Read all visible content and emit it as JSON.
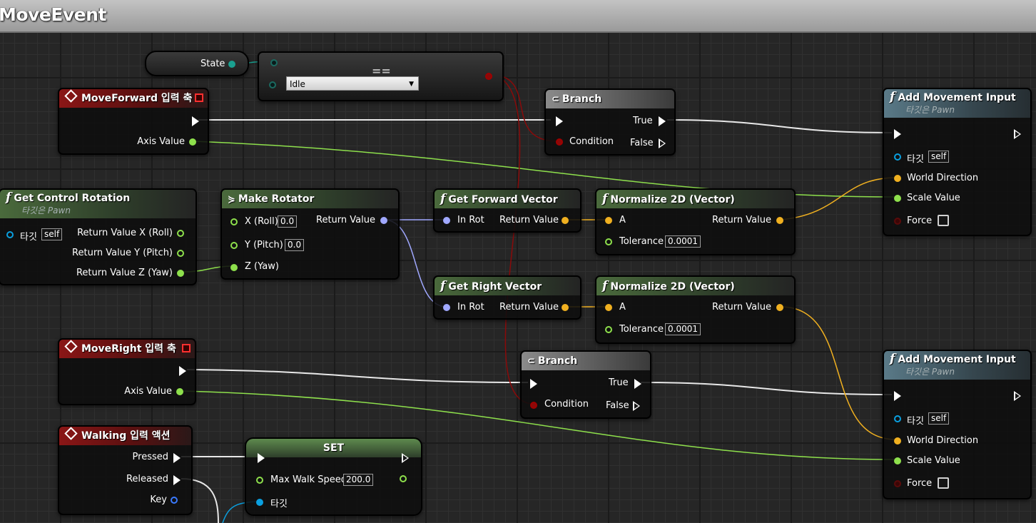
{
  "window": {
    "title": "MoveEvent"
  },
  "nodes": {
    "state": {
      "label": "State"
    },
    "equal": {
      "op": "==",
      "enum_value": "Idle"
    },
    "moveforward": {
      "title": "MoveForward 입력 축",
      "axis_value": "Axis Value"
    },
    "branch1": {
      "title": "Branch",
      "condition": "Condition",
      "true_label": "True",
      "false_label": "False"
    },
    "add1": {
      "title": "Add Movement Input",
      "subtitle": "타깃은 Pawn",
      "target": "타깃",
      "self": "self",
      "world_direction": "World Direction",
      "scale_value": "Scale Value",
      "force": "Force"
    },
    "getcontrol": {
      "title": "Get Control Rotation",
      "subtitle": "타깃은 Pawn",
      "target": "타깃",
      "self": "self",
      "rx": "Return Value X (Roll)",
      "ry": "Return Value Y (Pitch)",
      "rz": "Return Value Z (Yaw)"
    },
    "makerot": {
      "title": "Make Rotator",
      "x": "X (Roll)",
      "x_val": "0.0",
      "y": "Y (Pitch)",
      "y_val": "0.0",
      "z": "Z (Yaw)",
      "ret": "Return Value"
    },
    "getforward": {
      "title": "Get Forward Vector",
      "in": "In Rot",
      "ret": "Return Value"
    },
    "norm1": {
      "title": "Normalize 2D (Vector)",
      "a": "A",
      "ret": "Return Value",
      "tol": "Tolerance",
      "tol_val": "0.0001"
    },
    "getright": {
      "title": "Get Right Vector",
      "in": "In Rot",
      "ret": "Return Value"
    },
    "norm2": {
      "title": "Normalize 2D (Vector)",
      "a": "A",
      "ret": "Return Value",
      "tol": "Tolerance",
      "tol_val": "0.0001"
    },
    "moveright": {
      "title": "MoveRight 입력 축",
      "axis_value": "Axis Value"
    },
    "branch2": {
      "title": "Branch",
      "condition": "Condition",
      "true_label": "True",
      "false_label": "False"
    },
    "add2": {
      "title": "Add Movement Input",
      "subtitle": "타깃은 Pawn",
      "target": "타깃",
      "self": "self",
      "world_direction": "World Direction",
      "scale_value": "Scale Value",
      "force": "Force"
    },
    "walking": {
      "title": "Walking 입력 액션",
      "pressed": "Pressed",
      "released": "Released",
      "key": "Key"
    },
    "set": {
      "title": "SET",
      "field": "Max Walk Speed",
      "value": "200.0",
      "target": "타깃"
    }
  },
  "colors": {
    "exec": "#ffffff",
    "float": "#8ee04c",
    "vector": "#f0b020",
    "rotator": "#a0a8ff",
    "bool": "#8a0a0a",
    "object": "#0aa0e0",
    "enum": "#1aa090"
  }
}
